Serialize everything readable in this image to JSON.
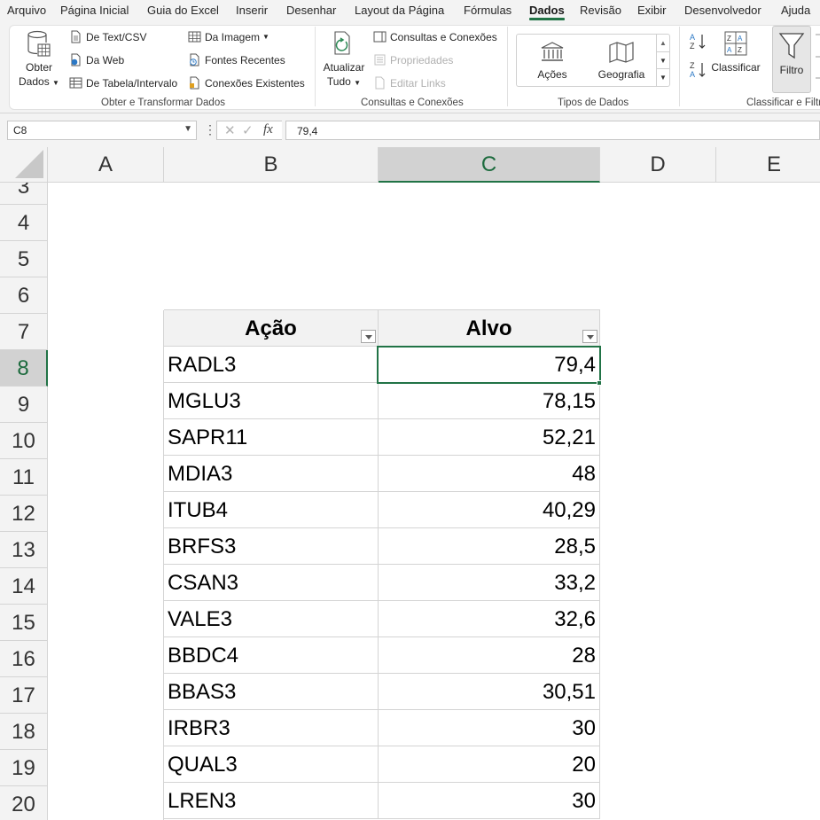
{
  "menu": {
    "tabs": [
      {
        "label": "Arquivo"
      },
      {
        "label": "Página Inicial"
      },
      {
        "label": "Guia do Excel"
      },
      {
        "label": "Inserir"
      },
      {
        "label": "Desenhar"
      },
      {
        "label": "Layout da Página"
      },
      {
        "label": "Fórmulas"
      },
      {
        "label": "Dados"
      },
      {
        "label": "Revisão"
      },
      {
        "label": "Exibir"
      },
      {
        "label": "Desenvolvedor"
      },
      {
        "label": "Ajuda"
      }
    ],
    "active": "Dados"
  },
  "ribbon": {
    "get_data": {
      "line1": "Obter",
      "line2": "Dados"
    },
    "from_text_csv": "De Text/CSV",
    "from_web": "Da Web",
    "from_table": "De Tabela/Intervalo",
    "from_image": "Da Imagem",
    "recent_sources": "Fontes Recentes",
    "existing_connections": "Conexões Existentes",
    "group_get_transform": "Obter e Transformar Dados",
    "refresh_all": {
      "line1": "Atualizar",
      "line2": "Tudo"
    },
    "queries_connections": "Consultas e Conexões",
    "properties": "Propriedades",
    "edit_links": "Editar Links",
    "group_queries": "Consultas e Conexões",
    "stocks": "Ações",
    "geography": "Geografia",
    "group_data_types": "Tipos de Dados",
    "sort": "Classificar",
    "filter": "Filtro",
    "group_sort_filter": "Classificar e Filtrar"
  },
  "formula_bar": {
    "name_box": "C8",
    "formula": "79,4"
  },
  "sheet": {
    "columns": [
      "A",
      "B",
      "C",
      "D",
      "E"
    ],
    "selected_column": "C",
    "rows": [
      "3",
      "4",
      "5",
      "6",
      "7",
      "8",
      "9",
      "10",
      "11",
      "12",
      "13",
      "14",
      "15",
      "16",
      "17",
      "18",
      "19",
      "20"
    ],
    "selected_row": "8",
    "table_headers": [
      "Ação",
      "Alvo"
    ],
    "table_rows": [
      {
        "acao": "RADL3",
        "alvo": "79,4"
      },
      {
        "acao": "MGLU3",
        "alvo": "78,15"
      },
      {
        "acao": "SAPR11",
        "alvo": "52,21"
      },
      {
        "acao": "MDIA3",
        "alvo": "48"
      },
      {
        "acao": "ITUB4",
        "alvo": "40,29"
      },
      {
        "acao": "BRFS3",
        "alvo": "28,5"
      },
      {
        "acao": "CSAN3",
        "alvo": "33,2"
      },
      {
        "acao": "VALE3",
        "alvo": "32,6"
      },
      {
        "acao": "BBDC4",
        "alvo": "28"
      },
      {
        "acao": "BBAS3",
        "alvo": "30,51"
      },
      {
        "acao": "IRBR3",
        "alvo": "30"
      },
      {
        "acao": "QUAL3",
        "alvo": "20"
      },
      {
        "acao": "LREN3",
        "alvo": "30"
      }
    ]
  }
}
